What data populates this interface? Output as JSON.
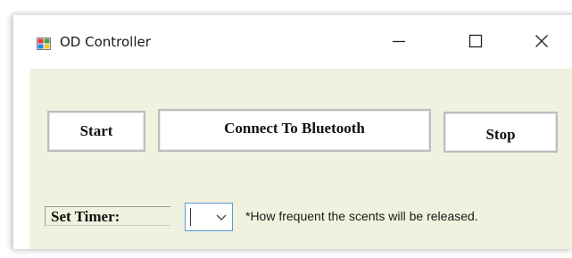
{
  "window": {
    "title": "OD Controller",
    "app_icon": "windows-forms-icon",
    "controls": {
      "minimize_icon": "minimize-icon",
      "maximize_icon": "maximize-icon",
      "close_icon": "close-icon"
    }
  },
  "buttons": {
    "start_label": "Start",
    "connect_label": "Connect To Bluetooth",
    "stop_label": "Stop"
  },
  "timer": {
    "label": "Set Timer:",
    "selected_value": "",
    "dropdown_icon": "chevron-down-icon",
    "hint": "*How frequent the scents will be released."
  },
  "colors": {
    "client_background": "#f1f1df",
    "focus_border": "#5b9bd5"
  }
}
